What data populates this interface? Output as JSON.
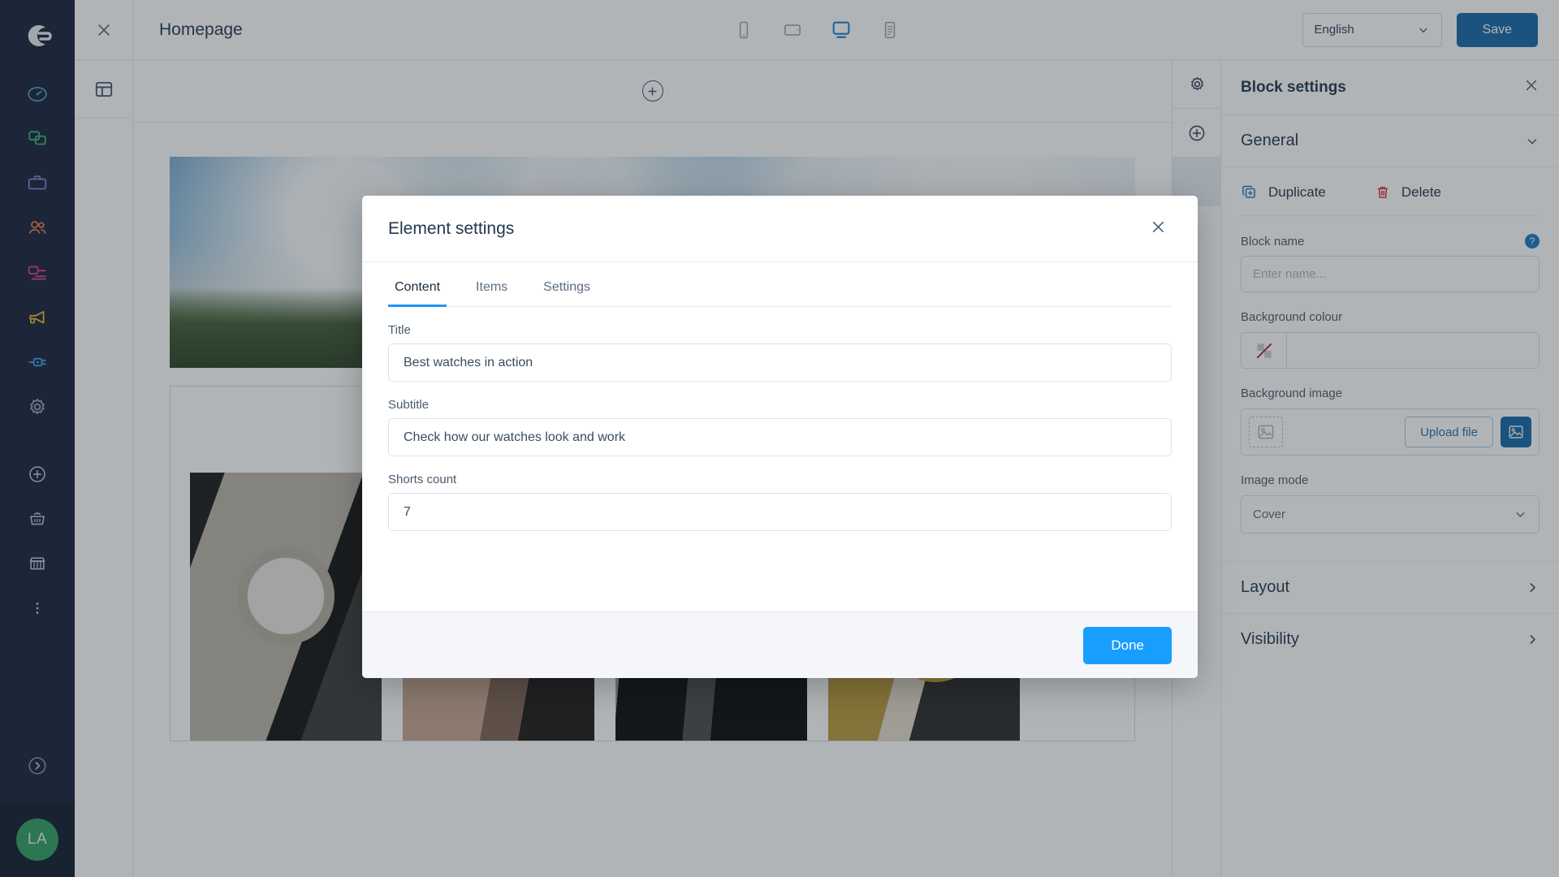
{
  "brand": {
    "logo_icon": "shopware-logo-icon",
    "accent": "#1668a8",
    "done_accent": "#189eff"
  },
  "left_rail": {
    "items": [
      {
        "name": "dashboard",
        "icon": "gauge-icon",
        "color": "#4e9ec4"
      },
      {
        "name": "catalogues",
        "icon": "layers-icon",
        "color": "#3cb179"
      },
      {
        "name": "orders",
        "icon": "briefcase-icon",
        "color": "#7b7fd4"
      },
      {
        "name": "customers",
        "icon": "users-icon",
        "color": "#e07a4a"
      },
      {
        "name": "content",
        "icon": "content-icon",
        "color": "#d9427e"
      },
      {
        "name": "marketing",
        "icon": "megaphone-icon",
        "color": "#e5b82e"
      },
      {
        "name": "extensions",
        "icon": "plug-icon",
        "color": "#3aa3e8"
      },
      {
        "name": "settings",
        "icon": "gear-icon",
        "color": "#96a4b5"
      }
    ],
    "quick_items": [
      {
        "name": "add",
        "icon": "plus-circle-icon",
        "color": "#c3cbd6"
      },
      {
        "name": "basket",
        "icon": "basket-icon",
        "color": "#c3cbd6"
      },
      {
        "name": "storefront",
        "icon": "store-icon",
        "color": "#c3cbd6"
      },
      {
        "name": "more",
        "icon": "more-vertical-icon",
        "color": "#c3cbd6"
      }
    ],
    "collapse_icon": "chevron-right-circle-icon",
    "avatar_initials": "LA"
  },
  "topbar": {
    "close_icon": "close-icon",
    "page_title": "Homepage",
    "viewports": [
      {
        "name": "mobile",
        "icon": "mobile-icon",
        "active": false
      },
      {
        "name": "tablet",
        "icon": "tablet-icon",
        "active": false
      },
      {
        "name": "desktop",
        "icon": "desktop-icon",
        "active": true
      },
      {
        "name": "list",
        "icon": "list-view-icon",
        "active": false
      }
    ],
    "language": "English",
    "language_chevron": "chevron-down-icon",
    "save_label": "Save"
  },
  "blocks_rail": {
    "panel_icon": "layout-panel-icon"
  },
  "canvas": {
    "add_block_icon": "plus-circle-icon",
    "shorts": [
      {
        "name": "short-1"
      },
      {
        "name": "short-2"
      },
      {
        "name": "short-3"
      },
      {
        "name": "short-4"
      }
    ]
  },
  "side_rail": {
    "items": [
      {
        "name": "block-settings",
        "icon": "gear-icon",
        "active": false
      },
      {
        "name": "add-block",
        "icon": "plus-circle-icon",
        "active": false
      },
      {
        "name": "selected-block",
        "icon": "block-icon",
        "active": true
      }
    ]
  },
  "right_panel": {
    "title": "Block settings",
    "close_icon": "close-icon",
    "general": {
      "label": "General",
      "chevron": "chevron-down-icon"
    },
    "duplicate": {
      "label": "Duplicate",
      "icon": "duplicate-icon"
    },
    "delete": {
      "label": "Delete",
      "icon": "trash-icon"
    },
    "block_name": {
      "label": "Block name",
      "placeholder": "Enter name...",
      "value": "",
      "help_icon": "help-icon",
      "help_glyph": "?"
    },
    "background_colour": {
      "label": "Background colour",
      "swatch_icon": "no-color-icon",
      "value": ""
    },
    "background_image": {
      "label": "Background image",
      "placeholder_icon": "image-placeholder-icon",
      "upload_label": "Upload file",
      "media_icon": "image-icon"
    },
    "image_mode": {
      "label": "Image mode",
      "value": "Cover",
      "chevron": "chevron-down-icon"
    },
    "sections": [
      {
        "label": "Layout",
        "chevron": "chevron-right-icon"
      },
      {
        "label": "Visibility",
        "chevron": "chevron-right-icon"
      }
    ]
  },
  "modal": {
    "title": "Element settings",
    "close_icon": "close-icon",
    "tabs": [
      {
        "label": "Content",
        "active": true
      },
      {
        "label": "Items",
        "active": false
      },
      {
        "label": "Settings",
        "active": false
      }
    ],
    "fields": [
      {
        "name": "title",
        "label": "Title",
        "value": "Best watches in action"
      },
      {
        "name": "subtitle",
        "label": "Subtitle",
        "value": "Check how our watches look and work"
      },
      {
        "name": "shorts-count",
        "label": "Shorts count",
        "value": "7"
      }
    ],
    "done_label": "Done"
  }
}
